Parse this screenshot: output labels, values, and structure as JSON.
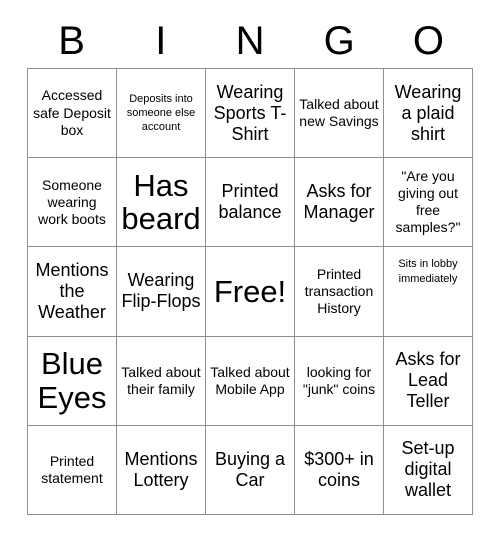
{
  "card": {
    "title": "BINGO",
    "header_letters": [
      "B",
      "I",
      "N",
      "G",
      "O"
    ],
    "grid_size": "5x5",
    "free_space": "Free!",
    "border_color": "#8f8f8f",
    "text_color": "#000000",
    "background_color": "#ffffff",
    "columns": [
      {
        "letter": "B",
        "cells": [
          {
            "text": "Accessed safe Deposit box",
            "size": "sm",
            "align": "mid"
          },
          {
            "text": "Someone wearing work boots",
            "size": "sm",
            "align": "mid"
          },
          {
            "text": "Mentions the Weather",
            "size": "md",
            "align": "mid"
          },
          {
            "text": "Blue Eyes",
            "size": "xl",
            "align": "mid"
          },
          {
            "text": "Printed statement",
            "size": "sm",
            "align": "mid"
          }
        ]
      },
      {
        "letter": "I",
        "cells": [
          {
            "text": "Deposits into someone else account",
            "size": "xs",
            "align": "mid"
          },
          {
            "text": "Has beard",
            "size": "xl",
            "align": "mid"
          },
          {
            "text": "Wearing Flip-Flops",
            "size": "md",
            "align": "mid"
          },
          {
            "text": "Talked about their family",
            "size": "sm",
            "align": "mid"
          },
          {
            "text": "Mentions Lottery",
            "size": "md",
            "align": "mid"
          }
        ]
      },
      {
        "letter": "N",
        "cells": [
          {
            "text": "Wearing Sports T-Shirt",
            "size": "md",
            "align": "mid"
          },
          {
            "text": "Printed balance",
            "size": "md",
            "align": "mid"
          },
          {
            "text": "Free!",
            "size": "xl",
            "align": "mid"
          },
          {
            "text": "Talked about Mobile App",
            "size": "sm",
            "align": "mid"
          },
          {
            "text": "Buying a Car",
            "size": "md",
            "align": "mid"
          }
        ]
      },
      {
        "letter": "G",
        "cells": [
          {
            "text": "Talked about new Savings",
            "size": "sm",
            "align": "mid"
          },
          {
            "text": "Asks for Manager",
            "size": "md",
            "align": "mid"
          },
          {
            "text": "Printed transaction History",
            "size": "sm",
            "align": "mid"
          },
          {
            "text": "looking for \"junk\" coins",
            "size": "sm",
            "align": "mid"
          },
          {
            "text": "$300+ in coins",
            "size": "md",
            "align": "mid"
          }
        ]
      },
      {
        "letter": "O",
        "cells": [
          {
            "text": "Wearing a plaid shirt",
            "size": "md",
            "align": "mid"
          },
          {
            "text": "\"Are you giving out free samples?\"",
            "size": "sm",
            "align": "mid"
          },
          {
            "text": "Sits in lobby immediately",
            "size": "xs",
            "align": "top"
          },
          {
            "text": "Asks for Lead Teller",
            "size": "md",
            "align": "mid"
          },
          {
            "text": "Set-up digital wallet",
            "size": "md",
            "align": "mid"
          }
        ]
      }
    ]
  }
}
